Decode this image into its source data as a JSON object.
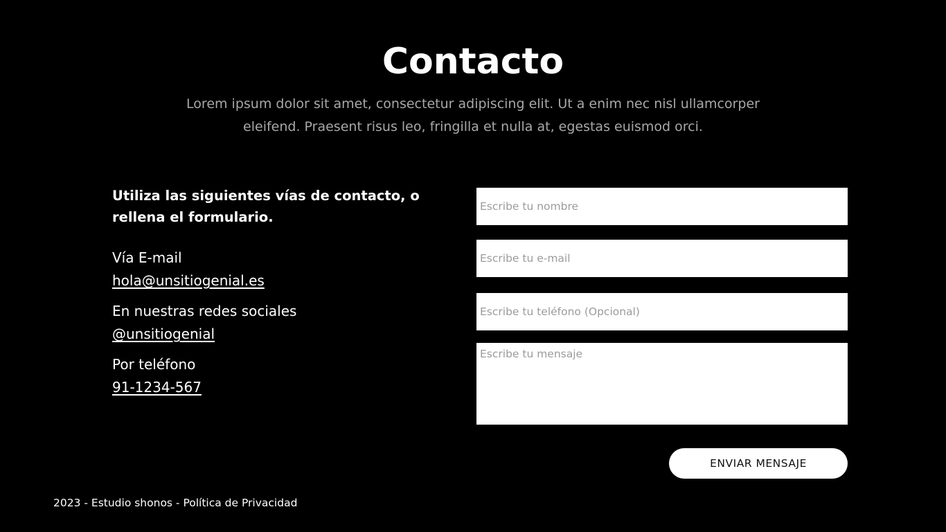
{
  "colors": {
    "background": "#000000",
    "text": "#ffffff",
    "subtitle_text": "#a8a8a8",
    "field_background": "#ffffff",
    "placeholder": "#9b9b9b",
    "button_background": "#ffffff",
    "button_text": "#111111"
  },
  "header": {
    "title": "Contacto",
    "subtitle": "Lorem ipsum dolor sit amet, consectetur adipiscing elit. Ut a enim nec nisl ullamcorper eleifend. Praesent risus leo, fringilla et nulla at, egestas euismod orci."
  },
  "contact": {
    "intro": "Utiliza las siguientes vías de contacto, o rellena el formulario.",
    "channels": [
      {
        "label": "Vía E-mail",
        "value": "hola@unsitiogenial.es"
      },
      {
        "label": "En nuestras redes sociales",
        "value": "@unsitiogenial"
      },
      {
        "label": "Por teléfono",
        "value": "91-1234-567"
      }
    ]
  },
  "form": {
    "name_placeholder": "Escribe tu nombre",
    "name_value": "",
    "email_placeholder": "Escribe tu e-mail",
    "email_value": "",
    "phone_placeholder": "Escribe tu teléfono (Opcional)",
    "phone_value": "",
    "message_placeholder": "Escribe tu mensaje",
    "message_value": "",
    "submit_label": "ENVIAR MENSAJE"
  },
  "footer": {
    "year": "2023",
    "separator": " - ",
    "studio": "Estudio shonos",
    "privacy": "Política de Privacidad"
  }
}
